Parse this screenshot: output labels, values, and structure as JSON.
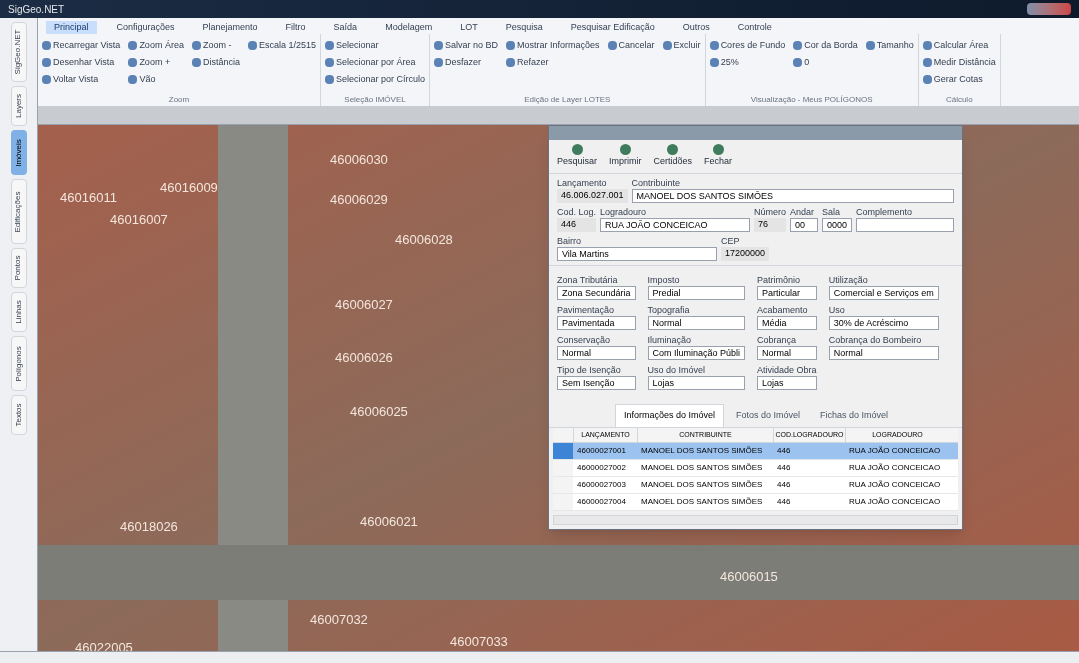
{
  "window": {
    "title": "SigGeo.NET"
  },
  "ribbon_tabs": [
    {
      "label": "Principal",
      "selected": true
    },
    {
      "label": "Configurações",
      "selected": false
    },
    {
      "label": "Planejamento",
      "selected": false
    },
    {
      "label": "Filtro",
      "selected": false
    },
    {
      "label": "Saída",
      "selected": false
    },
    {
      "label": "Modelagem",
      "selected": false
    },
    {
      "label": "LOT",
      "selected": false
    },
    {
      "label": "Pesquisa",
      "selected": false
    },
    {
      "label": "Pesquisar Edificação",
      "selected": false
    },
    {
      "label": "Outros",
      "selected": false
    },
    {
      "label": "Controle",
      "selected": false
    }
  ],
  "ribbon_groups": [
    {
      "title": "Zoom",
      "columns": [
        [
          "Recarregar Vista",
          "Desenhar Vista",
          "Voltar Vista"
        ],
        [
          "Zoom Área",
          "Zoom +",
          "Vão"
        ],
        [
          "Zoom -",
          "Distância"
        ],
        [
          "Escala 1/2515"
        ]
      ]
    },
    {
      "title": "Seleção IMÓVEL",
      "columns": [
        [
          "Selecionar",
          "Selecionar por Área",
          "Selecionar por Círculo"
        ]
      ]
    },
    {
      "title": "Edição de Layer LOTES",
      "columns": [
        [
          "Salvar no BD",
          "Desfazer"
        ],
        [
          "Mostrar Informações",
          "Refazer"
        ],
        [
          "Cancelar"
        ],
        [
          "Excluir"
        ]
      ]
    },
    {
      "title": "Visualização - Meus POLÍGONOS",
      "columns": [
        [
          "Cores de Fundo",
          "25%"
        ],
        [
          "Cor da Borda",
          "0"
        ],
        [
          "Tamanho"
        ]
      ]
    },
    {
      "title": "Cálculo",
      "columns": [
        [
          "Calcular Área",
          "Medir Distância",
          "Gerar Cotas"
        ]
      ]
    }
  ],
  "side_tabs": [
    {
      "label": "SigGeo.NET",
      "selected": false
    },
    {
      "label": "Layers",
      "selected": false
    },
    {
      "label": "Imóveis",
      "selected": true
    },
    {
      "label": "Edificações",
      "selected": false
    },
    {
      "label": "Pontos",
      "selected": false
    },
    {
      "label": "Linhas",
      "selected": false
    },
    {
      "label": "Polígonos",
      "selected": false
    },
    {
      "label": "Textos",
      "selected": false
    }
  ],
  "map_labels": [
    "46006030",
    "46006029",
    "46006028",
    "46006027",
    "46006026",
    "46006025",
    "46016009",
    "46016007",
    "46016011",
    "46006021",
    "46006015",
    "46018026",
    "46007033",
    "46007032",
    "46022005"
  ],
  "dialog": {
    "toolbar": [
      "Pesquisar",
      "Imprimir",
      "Certidões",
      "Fechar"
    ],
    "header_fields": [
      [
        {
          "label": "Lançamento",
          "value": "46.006.027.001",
          "boxed": false
        },
        {
          "label": "Contribuinte",
          "value": "MANOEL DOS SANTOS SIMÕES",
          "boxed": true
        }
      ],
      [
        {
          "label": "Cod. Log.",
          "value": "446",
          "boxed": false
        },
        {
          "label": "Logradouro",
          "value": "RUA JOÃO CONCEICAO",
          "boxed": true
        },
        {
          "label": "Número",
          "value": "76",
          "boxed": false
        },
        {
          "label": "Andar",
          "value": "00",
          "boxed": true
        },
        {
          "label": "Sala",
          "value": "0000",
          "boxed": true
        },
        {
          "label": "Complemento",
          "boxed": true
        }
      ],
      [
        {
          "label": "Bairro",
          "value": "Vila Martins",
          "boxed": true
        },
        {
          "label": "CEP",
          "value": "17200000",
          "boxed": false
        }
      ]
    ],
    "fields": [
      {
        "label": "Zona Tributária",
        "value": "Zona Secundária"
      },
      {
        "label": "Imposto",
        "value": "Predial"
      },
      {
        "label": "Patrimônio",
        "value": "Particular"
      },
      {
        "label": "Utilização",
        "value": "Comercial e Serviços em"
      },
      {
        "label": "Pavimentação",
        "value": "Pavimentada"
      },
      {
        "label": "Topografia",
        "value": "Normal"
      },
      {
        "label": "Acabamento",
        "value": "Média"
      },
      {
        "label": "Uso",
        "value": "30% de Acréscimo"
      },
      {
        "label": "Conservação",
        "value": "Normal"
      },
      {
        "label": "Iluminação",
        "value": "Com Iluminação Públi"
      },
      {
        "label": "Cobrança",
        "value": "Normal"
      },
      {
        "label": "Cobrança do Bombeiro",
        "value": "Normal"
      },
      {
        "label": "Tipo de Isenção",
        "value": "Sem Isenção"
      },
      {
        "label": "Uso do Imóvel",
        "value": "Lojas"
      },
      {
        "label": "Atividade Obra",
        "value": "Lojas"
      }
    ],
    "tabs": [
      {
        "label": "Informações do Imóvel",
        "selected": true
      },
      {
        "label": "Fotos do Imóvel",
        "selected": false
      },
      {
        "label": "Fichas do Imóvel",
        "selected": false
      }
    ],
    "table": {
      "columns": [
        "LANÇAMENTO",
        "CONTRIBUINTE",
        "COD.LOGRADOURO",
        "LOGRADOURO"
      ],
      "rows": [
        {
          "cells": [
            "46000027001",
            "MANOEL DOS SANTOS SIMÕES",
            "446",
            "RUA JOÃO CONCEICAO"
          ],
          "selected": true
        },
        {
          "cells": [
            "46000027002",
            "MANOEL DOS SANTOS SIMÕES",
            "446",
            "RUA JOÃO CONCEICAO"
          ],
          "selected": false
        },
        {
          "cells": [
            "46000027003",
            "MANOEL DOS SANTOS SIMÕES",
            "446",
            "RUA JOÃO CONCEICAO"
          ],
          "selected": false
        },
        {
          "cells": [
            "46000027004",
            "MANOEL DOS SANTOS SIMÕES",
            "446",
            "RUA JOÃO CONCEICAO"
          ],
          "selected": false
        }
      ]
    }
  }
}
